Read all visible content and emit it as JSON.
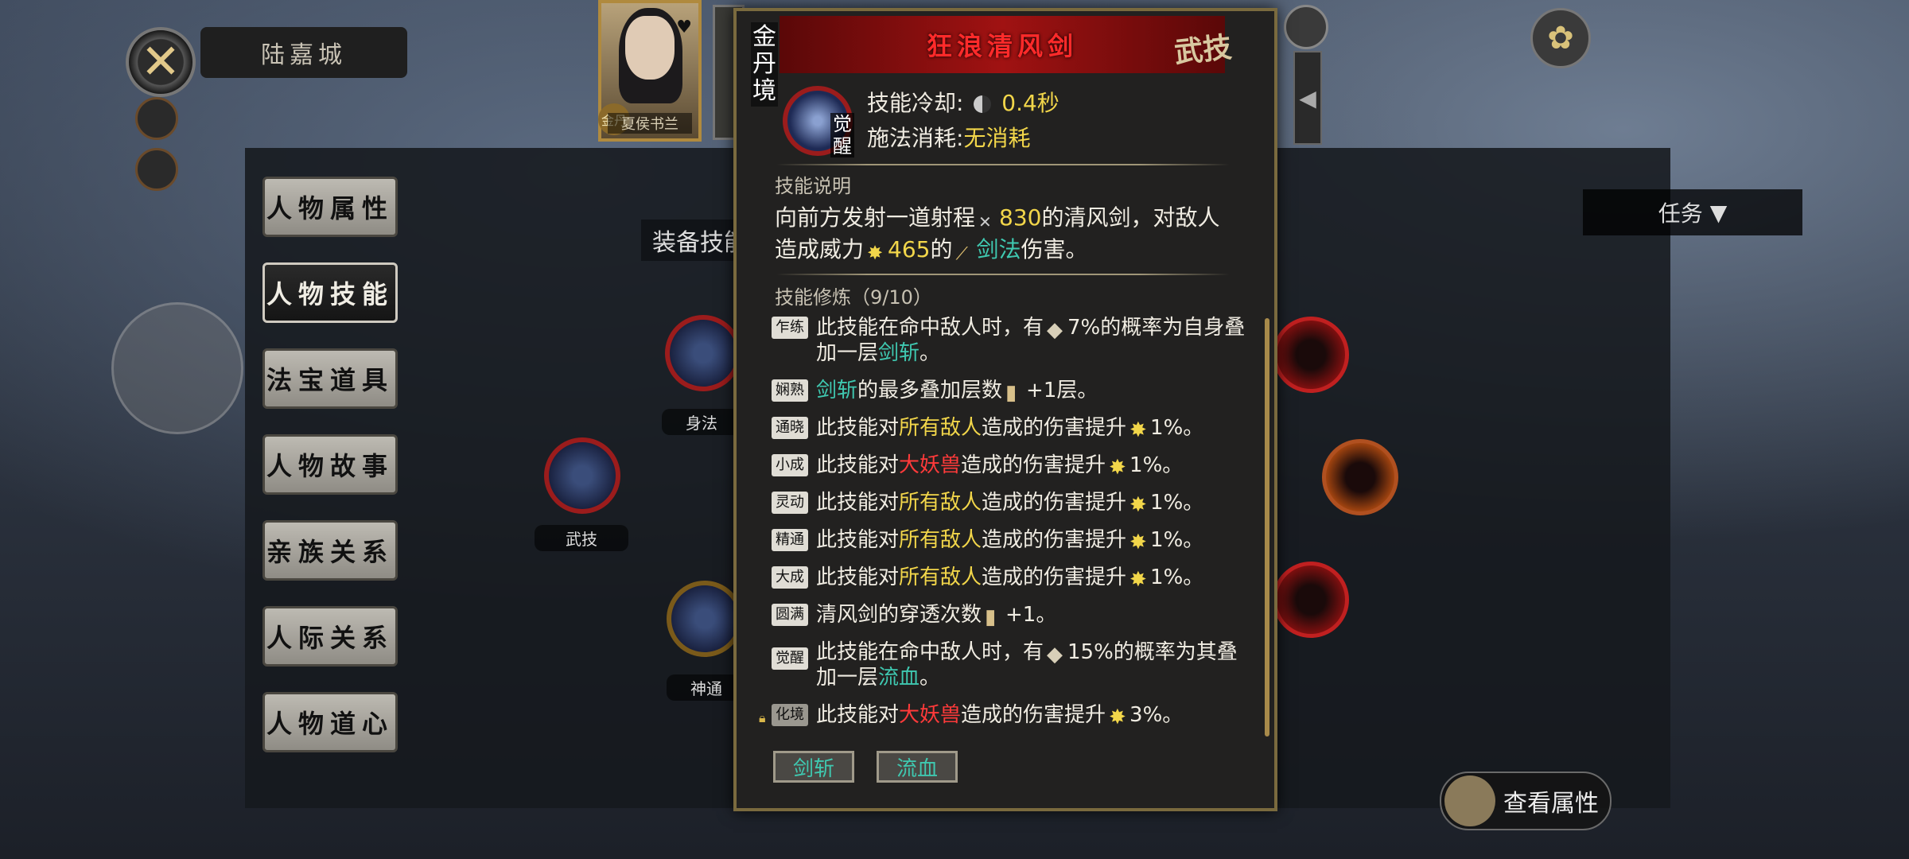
{
  "top_left": {
    "close_icon": "close-x-icon",
    "page_title": "陆嘉城"
  },
  "portrait": {
    "name": "夏侯书兰",
    "realm_badge": "金丹"
  },
  "menu": [
    {
      "label": "人物属性",
      "active": false
    },
    {
      "label": "人物技能",
      "active": true
    },
    {
      "label": "法宝道具",
      "active": false
    },
    {
      "label": "人物故事",
      "active": false
    },
    {
      "label": "亲族关系",
      "active": false
    },
    {
      "label": "人际关系",
      "active": false
    },
    {
      "label": "人物道心",
      "active": false
    }
  ],
  "equip_label": "装备技能",
  "nodes": {
    "movement": "身法",
    "martial": "武技",
    "divine": "神通"
  },
  "task": {
    "label": "任务"
  },
  "view_attr_button": "查看属性",
  "popup": {
    "realm": "金丹境",
    "skill_name": "狂浪清风剑",
    "type": "武技",
    "awaken": "觉醒",
    "cooldown_label": "技能冷却:",
    "cooldown_value": "0.4秒",
    "cost_label": "施法消耗:",
    "cost_value": "无消耗",
    "desc_title": "技能说明",
    "desc_parts": {
      "p1": "向前方发射一道射程",
      "range": "830",
      "p2": "的清风剑，对敌人造成威力",
      "power": "465",
      "p3": "的",
      "type_word": "剑法",
      "p4": "伤害。"
    },
    "train_title": "技能修炼（9/10）",
    "training": [
      {
        "tag": "乍练",
        "a": "此技能在命中敌人时，有",
        "b": "7%的概率为自身叠加一层",
        "hl": "剑斩",
        "hl_color": "teal",
        "c": "。"
      },
      {
        "tag": "娴熟",
        "pre_hl": "剑斩",
        "a": "的最多叠加层数",
        "b": "+1层。"
      },
      {
        "tag": "通晓",
        "a": "此技能对",
        "hl": "所有敌人",
        "hl_color": "yellow",
        "b": "造成的伤害提升",
        "c": "1%。"
      },
      {
        "tag": "小成",
        "a": "此技能对",
        "hl": "大妖兽",
        "hl_color": "red",
        "b": "造成的伤害提升",
        "c": "1%。"
      },
      {
        "tag": "灵动",
        "a": "此技能对",
        "hl": "所有敌人",
        "hl_color": "yellow",
        "b": "造成的伤害提升",
        "c": "1%。"
      },
      {
        "tag": "精通",
        "a": "此技能对",
        "hl": "所有敌人",
        "hl_color": "yellow",
        "b": "造成的伤害提升",
        "c": "1%。"
      },
      {
        "tag": "大成",
        "a": "此技能对",
        "hl": "所有敌人",
        "hl_color": "yellow",
        "b": "造成的伤害提升",
        "c": "1%。"
      },
      {
        "tag": "圆满",
        "a": "清风剑的穿透次数",
        "b": "+1。"
      },
      {
        "tag": "觉醒",
        "a": "此技能在命中敌人时，有",
        "b": "15%的概率为其叠加一层",
        "hl": "流血",
        "hl_color": "teal",
        "c": "。"
      },
      {
        "tag": "化境",
        "locked": true,
        "a": "此技能对",
        "hl": "大妖兽",
        "hl_color": "red",
        "b": "造成的伤害提升",
        "c": "3%。"
      }
    ],
    "tag_buttons": [
      "剑斩",
      "流血"
    ]
  },
  "colors": {
    "yellow": "#f2d64a",
    "teal": "#3fc8b0",
    "red": "#ff3a3a",
    "title_red": "#ff2a2a"
  }
}
